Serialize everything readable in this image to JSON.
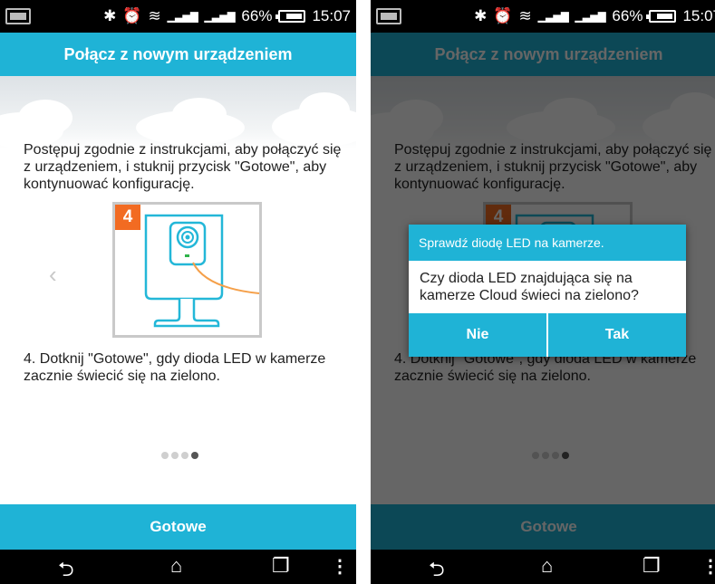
{
  "status_bar": {
    "battery": "66%",
    "time": "15:07"
  },
  "header": {
    "title": "Połącz z nowym urządzeniem"
  },
  "instructions": "Postępuj zgodnie z instrukcjami, aby połączyć się z urządzeniem, i stuknij przycisk \"Gotowe\", aby kontynuować konfigurację.",
  "step": {
    "number": "4",
    "text": "4. Dotknij \"Gotowe\", gdy dioda LED w kamerze zacznie świecić się na zielono."
  },
  "pager": {
    "total": 4,
    "active": 4,
    "prev_arrow": "‹"
  },
  "footer": {
    "done_label": "Gotowe"
  },
  "nav": {
    "back": "⮌",
    "home": "⌂",
    "recents": "❐",
    "more": "⋮"
  },
  "dialog": {
    "title": "Sprawdź diodę LED na kamerze.",
    "message": "Czy dioda LED znajdująca się na kamerze Cloud świeci na zielono?",
    "no_label": "Nie",
    "yes_label": "Tak"
  },
  "colors": {
    "accent": "#1fb3d6",
    "badge": "#f26b22",
    "led": "#2fb34a",
    "cable": "#f5a04a"
  }
}
